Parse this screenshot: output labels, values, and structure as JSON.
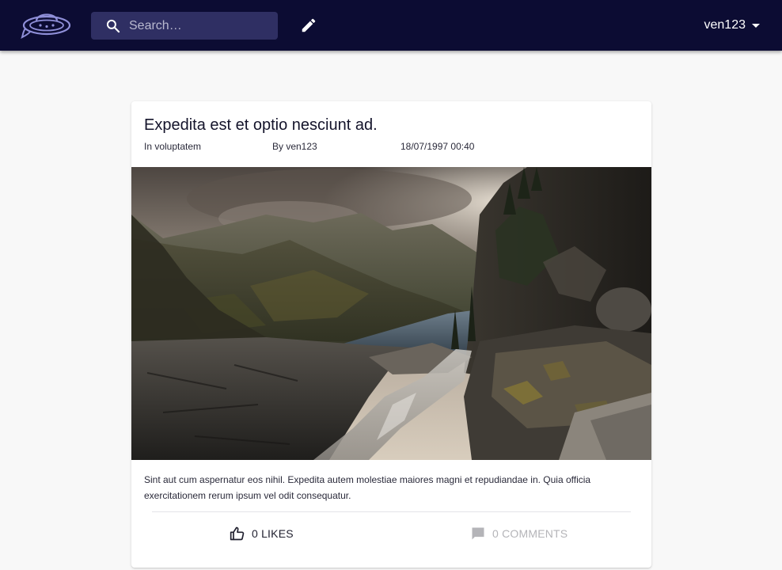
{
  "header": {
    "logo_icon": "ufo-chat-logo",
    "search": {
      "placeholder": "Search…",
      "value": ""
    },
    "edit_icon": "pencil-icon",
    "user": {
      "name": "ven123"
    }
  },
  "post": {
    "title": "Expedita est et optio nesciunt ad.",
    "category": "In voluptatem",
    "author": "By ven123",
    "date": "18/07/1997 00:40",
    "image": "mountain-lake-waterfall-photo",
    "body": "Sint aut cum aspernatur eos nihil. Expedita autem molestiae maiores magni et repudiandae in. Quia officia exercitationem rerum ipsum vel odit consequatur.",
    "likes_label": "0 LIKES",
    "comments_label": "0 COMMENTS"
  },
  "colors": {
    "topbar": "#0c0c33",
    "search_bg": "#2f2f63",
    "accent": "#8f8fd8",
    "page_bg": "#f8f8f8",
    "card_bg": "#ffffff",
    "muted": "#b4b4b8"
  }
}
